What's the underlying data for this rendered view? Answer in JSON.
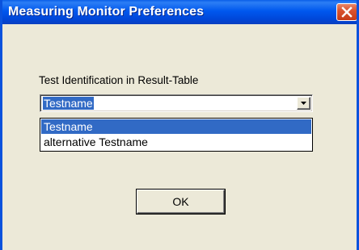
{
  "window": {
    "title": "Measuring Monitor Preferences",
    "close_icon": "close-x-icon"
  },
  "form": {
    "field_label": "Test Identification in Result-Table",
    "combo": {
      "selected_value": "Testname",
      "arrow_icon": "dropdown-arrow-icon",
      "options": [
        {
          "label": "Testname",
          "selected": true
        },
        {
          "label": "alternative Testname",
          "selected": false
        }
      ]
    },
    "ok_label": "OK"
  },
  "colors": {
    "titlebar": "#0058ee",
    "dialog_background": "#ece9d8",
    "selection": "#316ac5",
    "close_button": "#d9532f"
  }
}
